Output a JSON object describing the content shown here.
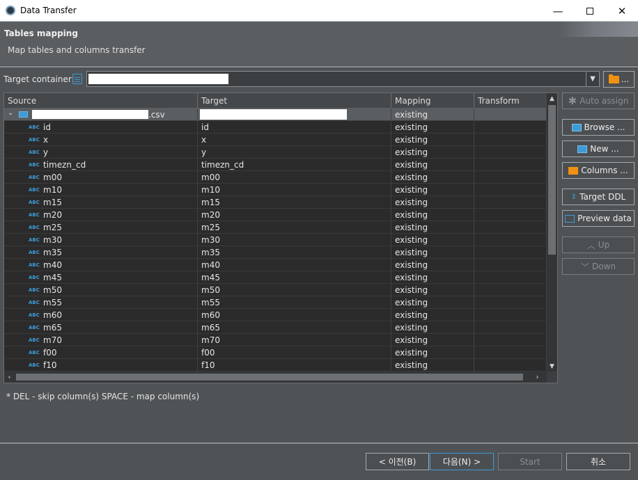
{
  "window": {
    "title": "Data Transfer",
    "minimize": "—",
    "close": "✕"
  },
  "banner": {
    "heading": "Tables mapping",
    "subtitle": "Map tables and columns transfer"
  },
  "target_container": {
    "label": "Target container:",
    "browse_label": "..."
  },
  "table": {
    "columns": [
      "Source",
      "Target",
      "Mapping",
      "Transform"
    ],
    "parent": {
      "source_suffix": ".csv",
      "mapping": "existing"
    },
    "rows": [
      {
        "source": "id",
        "target": "id",
        "mapping": "existing"
      },
      {
        "source": "x",
        "target": "x",
        "mapping": "existing"
      },
      {
        "source": "y",
        "target": "y",
        "mapping": "existing"
      },
      {
        "source": "timezn_cd",
        "target": "timezn_cd",
        "mapping": "existing"
      },
      {
        "source": "m00",
        "target": "m00",
        "mapping": "existing"
      },
      {
        "source": "m10",
        "target": "m10",
        "mapping": "existing"
      },
      {
        "source": "m15",
        "target": "m15",
        "mapping": "existing"
      },
      {
        "source": "m20",
        "target": "m20",
        "mapping": "existing"
      },
      {
        "source": "m25",
        "target": "m25",
        "mapping": "existing"
      },
      {
        "source": "m30",
        "target": "m30",
        "mapping": "existing"
      },
      {
        "source": "m35",
        "target": "m35",
        "mapping": "existing"
      },
      {
        "source": "m40",
        "target": "m40",
        "mapping": "existing"
      },
      {
        "source": "m45",
        "target": "m45",
        "mapping": "existing"
      },
      {
        "source": "m50",
        "target": "m50",
        "mapping": "existing"
      },
      {
        "source": "m55",
        "target": "m55",
        "mapping": "existing"
      },
      {
        "source": "m60",
        "target": "m60",
        "mapping": "existing"
      },
      {
        "source": "m65",
        "target": "m65",
        "mapping": "existing"
      },
      {
        "source": "m70",
        "target": "m70",
        "mapping": "existing"
      },
      {
        "source": "f00",
        "target": "f00",
        "mapping": "existing"
      },
      {
        "source": "f10",
        "target": "f10",
        "mapping": "existing"
      }
    ]
  },
  "side_buttons": {
    "auto_assign": "Auto assign",
    "browse": "Browse ...",
    "new": "New ...",
    "columns": "Columns ...",
    "target_ddl": "Target DDL",
    "preview_data": "Preview data",
    "up": "Up",
    "down": "Down"
  },
  "hint": "* DEL - skip column(s)  SPACE - map column(s)",
  "footer": {
    "back": "< 이전(B)",
    "next": "다음(N) >",
    "start": "Start",
    "cancel": "취소"
  },
  "colors": {
    "accent": "#3d9bd6",
    "folder": "#f29111",
    "background": "#4f5356",
    "table_bg": "#2b2b2b"
  }
}
